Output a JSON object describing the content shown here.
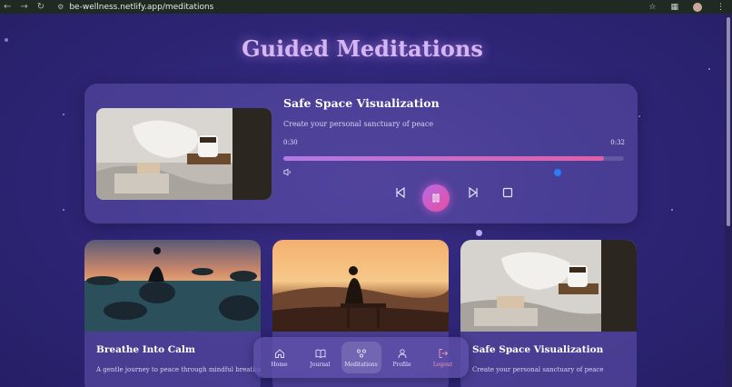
{
  "browser": {
    "url": "be-wellness.netlify.app/meditations"
  },
  "page": {
    "title": "Guided Meditations"
  },
  "player": {
    "title": "Safe Space Visualization",
    "description": "Create your personal sanctuary of peace",
    "current_time": "0:30",
    "total_time": "0:32",
    "progress": 0.94,
    "volume": 0.8
  },
  "cards": [
    {
      "title": "Breathe Into Calm",
      "description": "A gentle journey to peace through mindful breathing"
    },
    {
      "title": "",
      "description": ""
    },
    {
      "title": "Safe Space Visualization",
      "description": "Create your personal sanctuary of peace"
    }
  ],
  "nav": {
    "items": [
      {
        "label": "Home",
        "icon": "home-icon"
      },
      {
        "label": "Journal",
        "icon": "book-icon"
      },
      {
        "label": "Meditations",
        "icon": "meditation-icon",
        "active": true
      },
      {
        "label": "Profile",
        "icon": "user-icon"
      },
      {
        "label": "Logout",
        "icon": "logout-icon"
      }
    ]
  },
  "colors": {
    "accent_gradient_start": "#b46be8",
    "accent_gradient_end": "#e84e9e",
    "title": "#d6b5f5",
    "logout": "#f29ab0",
    "volume_knob": "#2e7bf6"
  }
}
